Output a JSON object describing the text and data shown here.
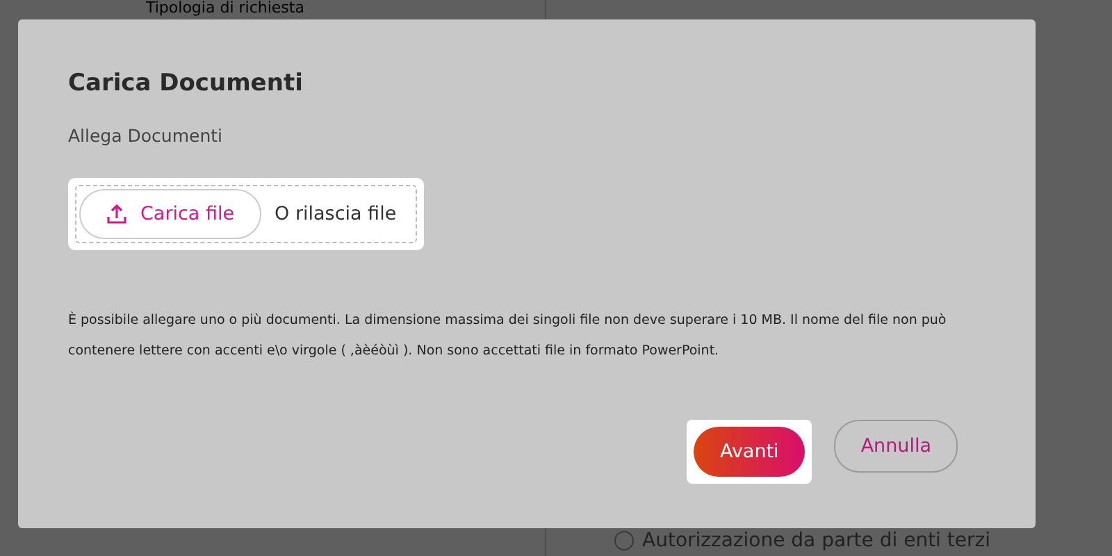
{
  "background": {
    "field_label": "Tipologia di richiesta",
    "radio_option": {
      "label": "Autorizzazione da parte di enti terzi",
      "selected": false
    }
  },
  "dialog": {
    "title": "Carica Documenti",
    "section_label": "Allega Documenti",
    "upload_button": "Carica file",
    "drop_hint": "O rilascia file",
    "note": "È possibile allegare uno o più documenti. La dimensione massima dei singoli file non deve superare i 10 MB. Il nome del file non può contenere lettere con accenti e\\o virgole ( ,àèéòùì ). Non sono accettati file in formato PowerPoint.",
    "buttons": [
      {
        "label": "Avanti",
        "kind": "primary"
      },
      {
        "label": "Annulla",
        "kind": "secondary"
      }
    ]
  }
}
